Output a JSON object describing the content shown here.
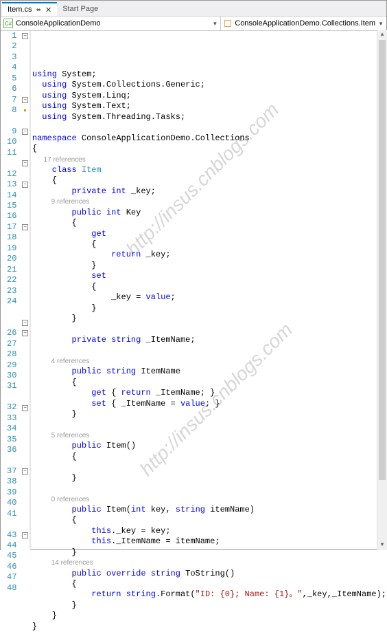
{
  "tabs": {
    "active": {
      "label": "Item.cs",
      "pin": "⬌",
      "close": "✕"
    },
    "inactive": {
      "label": "Start Page"
    }
  },
  "nav": {
    "left": "ConsoleApplicationDemo",
    "right": "ConsoleApplicationDemo.Collections.Item"
  },
  "watermark": "http://insus.cnblogs.com",
  "refs": {
    "r17": "17 references",
    "r9": "9 references",
    "r4": "4 references",
    "r5": "5 references",
    "r0": "0 references",
    "r14": "14 references"
  },
  "code": {
    "l1a": "using",
    "l1b": " System;",
    "l2a": "using",
    "l2b": " System.Collections.Generic;",
    "l3a": "using",
    "l3b": " System.Linq;",
    "l4a": "using",
    "l4b": " System.Text;",
    "l5a": "using",
    "l5b": " System.Threading.Tasks;",
    "l7a": "namespace",
    "l7b": " ConsoleApplicationDemo.Collections",
    "l8": "{",
    "l9a": "    class",
    "l9b": " Item",
    "l10": "    {",
    "l11a": "        private",
    "l11b": " int",
    "l11c": " _key;",
    "l12a": "        public",
    "l12b": " int",
    "l12c": " Key",
    "l13": "        {",
    "l14": "            get",
    "l15": "            {",
    "l16a": "                return",
    "l16b": " _key;",
    "l17": "            }",
    "l18": "            set",
    "l19": "            {",
    "l20a": "                _key = ",
    "l20b": "value",
    "l20c": ";",
    "l21": "            }",
    "l22": "        }",
    "l24a": "        private",
    "l24b": " string",
    "l24c": " _ItemName;",
    "l26a": "        public",
    "l26b": " string",
    "l26c": " ItemName",
    "l27": "        {",
    "l28a": "            get",
    "l28b": " { ",
    "l28c": "return",
    "l28d": " _ItemName; }",
    "l29a": "            set",
    "l29b": " { _ItemName = ",
    "l29c": "value",
    "l29d": "; }",
    "l30": "        }",
    "l32a": "        public",
    "l32b": " Item()",
    "l33": "        {",
    "l35": "        }",
    "l37a": "        public",
    "l37b": " Item(",
    "l37c": "int",
    "l37d": " key, ",
    "l37e": "string",
    "l37f": " itemName)",
    "l38": "        {",
    "l39a": "            this",
    "l39b": "._key = key;",
    "l40a": "            this",
    "l40b": "._ItemName = itemName;",
    "l41": "        }",
    "l43a": "        public",
    "l43b": " override",
    "l43c": " string",
    "l43d": " ToString()",
    "l44": "        {",
    "l45a": "            return",
    "l45b": " string",
    "l45c": ".Format(",
    "l45d": "\"ID: {0}; Name: {1}。\"",
    "l45e": ",_key,_ItemName);",
    "l46": "        }",
    "l47": "    }",
    "l48": "}"
  },
  "lineNumbers": [
    "1",
    "2",
    "3",
    "4",
    "5",
    "6",
    "7",
    "8",
    "",
    "9",
    "10",
    "11",
    "",
    "12",
    "13",
    "14",
    "15",
    "16",
    "17",
    "18",
    "19",
    "20",
    "21",
    "22",
    "23",
    "24",
    "",
    "",
    "26",
    "27",
    "28",
    "29",
    "30",
    "31",
    "",
    "32",
    "33",
    "34",
    "35",
    "36",
    "",
    "37",
    "38",
    "39",
    "40",
    "41",
    "",
    "43",
    "44",
    "45",
    "46",
    "47",
    "48"
  ],
  "foldMarks": {
    "1": "-",
    "7": "-",
    "8": "h",
    "10": "-",
    "13": "-",
    "15": "-",
    "19": "-",
    "28": "-",
    "29": "-",
    "36": "-",
    "42": "-",
    "48": "-"
  }
}
